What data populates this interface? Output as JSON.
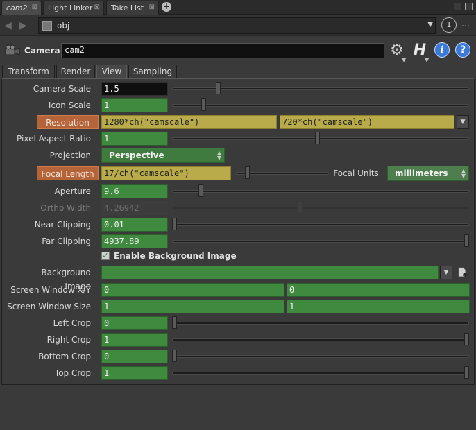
{
  "tabs": [
    {
      "label": "cam2",
      "active": true
    },
    {
      "label": "Light Linker",
      "active": false
    },
    {
      "label": "Take List",
      "active": false
    }
  ],
  "path": {
    "text": "obj",
    "pin": "1"
  },
  "node": {
    "type": "Camera",
    "name": "cam2",
    "help_letter": "H",
    "info_letter": "i",
    "question_letter": "?"
  },
  "param_tabs": [
    "Transform",
    "Render",
    "View",
    "Sampling"
  ],
  "params": {
    "camera_scale": {
      "label": "Camera Scale",
      "value": "1.5",
      "slider": 0.15
    },
    "icon_scale": {
      "label": "Icon Scale",
      "value": "1",
      "slider": 0.1
    },
    "resolution": {
      "label": "Resolution",
      "value1": "1280*ch(\"camscale\")",
      "value2": "720*ch(\"camscale\")"
    },
    "pixel_aspect": {
      "label": "Pixel Aspect Ratio",
      "value": "1",
      "slider": 0.49
    },
    "projection": {
      "label": "Projection",
      "value": "Perspective"
    },
    "focal_length": {
      "label": "Focal Length",
      "value": "17/ch(\"camscale\")",
      "slider": 0.1
    },
    "focal_units": {
      "label": "Focal Units",
      "value": "millimeters"
    },
    "aperture": {
      "label": "Aperture",
      "value": "9.6",
      "slider": 0.09
    },
    "ortho_width": {
      "label": "Ortho Width",
      "value": "4.26942",
      "slider": 0.43
    },
    "near_clipping": {
      "label": "Near Clipping",
      "value": "0.01",
      "slider": 0.0
    },
    "far_clipping": {
      "label": "Far Clipping",
      "value": "4937.89",
      "slider": 1.0
    },
    "enable_bg": {
      "label": "Enable Background Image",
      "checked": true
    },
    "bg_image": {
      "label": "Background Image",
      "value": ""
    },
    "screen_window_xy": {
      "label": "Screen Window X/Y",
      "value1": "0",
      "value2": "0"
    },
    "screen_window_size": {
      "label": "Screen Window Size",
      "value1": "1",
      "value2": "1"
    },
    "left_crop": {
      "label": "Left Crop",
      "value": "0",
      "slider": 0.0
    },
    "right_crop": {
      "label": "Right Crop",
      "value": "1",
      "slider": 1.0
    },
    "bottom_crop": {
      "label": "Bottom Crop",
      "value": "0",
      "slider": 0.0
    },
    "top_crop": {
      "label": "Top Crop",
      "value": "1",
      "slider": 1.0
    }
  },
  "colors": {
    "field_green": "#3f8a3f",
    "expr_yellow": "#b9ab4a",
    "label_orange": "#b5643a",
    "accent_blue": "#3b7ad6"
  },
  "icons": [
    "back-arrow-icon",
    "forward-arrow-icon",
    "network-icon",
    "dropdown-icon",
    "camera-icon",
    "gear-icon",
    "info-icon",
    "help-icon",
    "file-chooser-icon",
    "checkmark-icon"
  ]
}
